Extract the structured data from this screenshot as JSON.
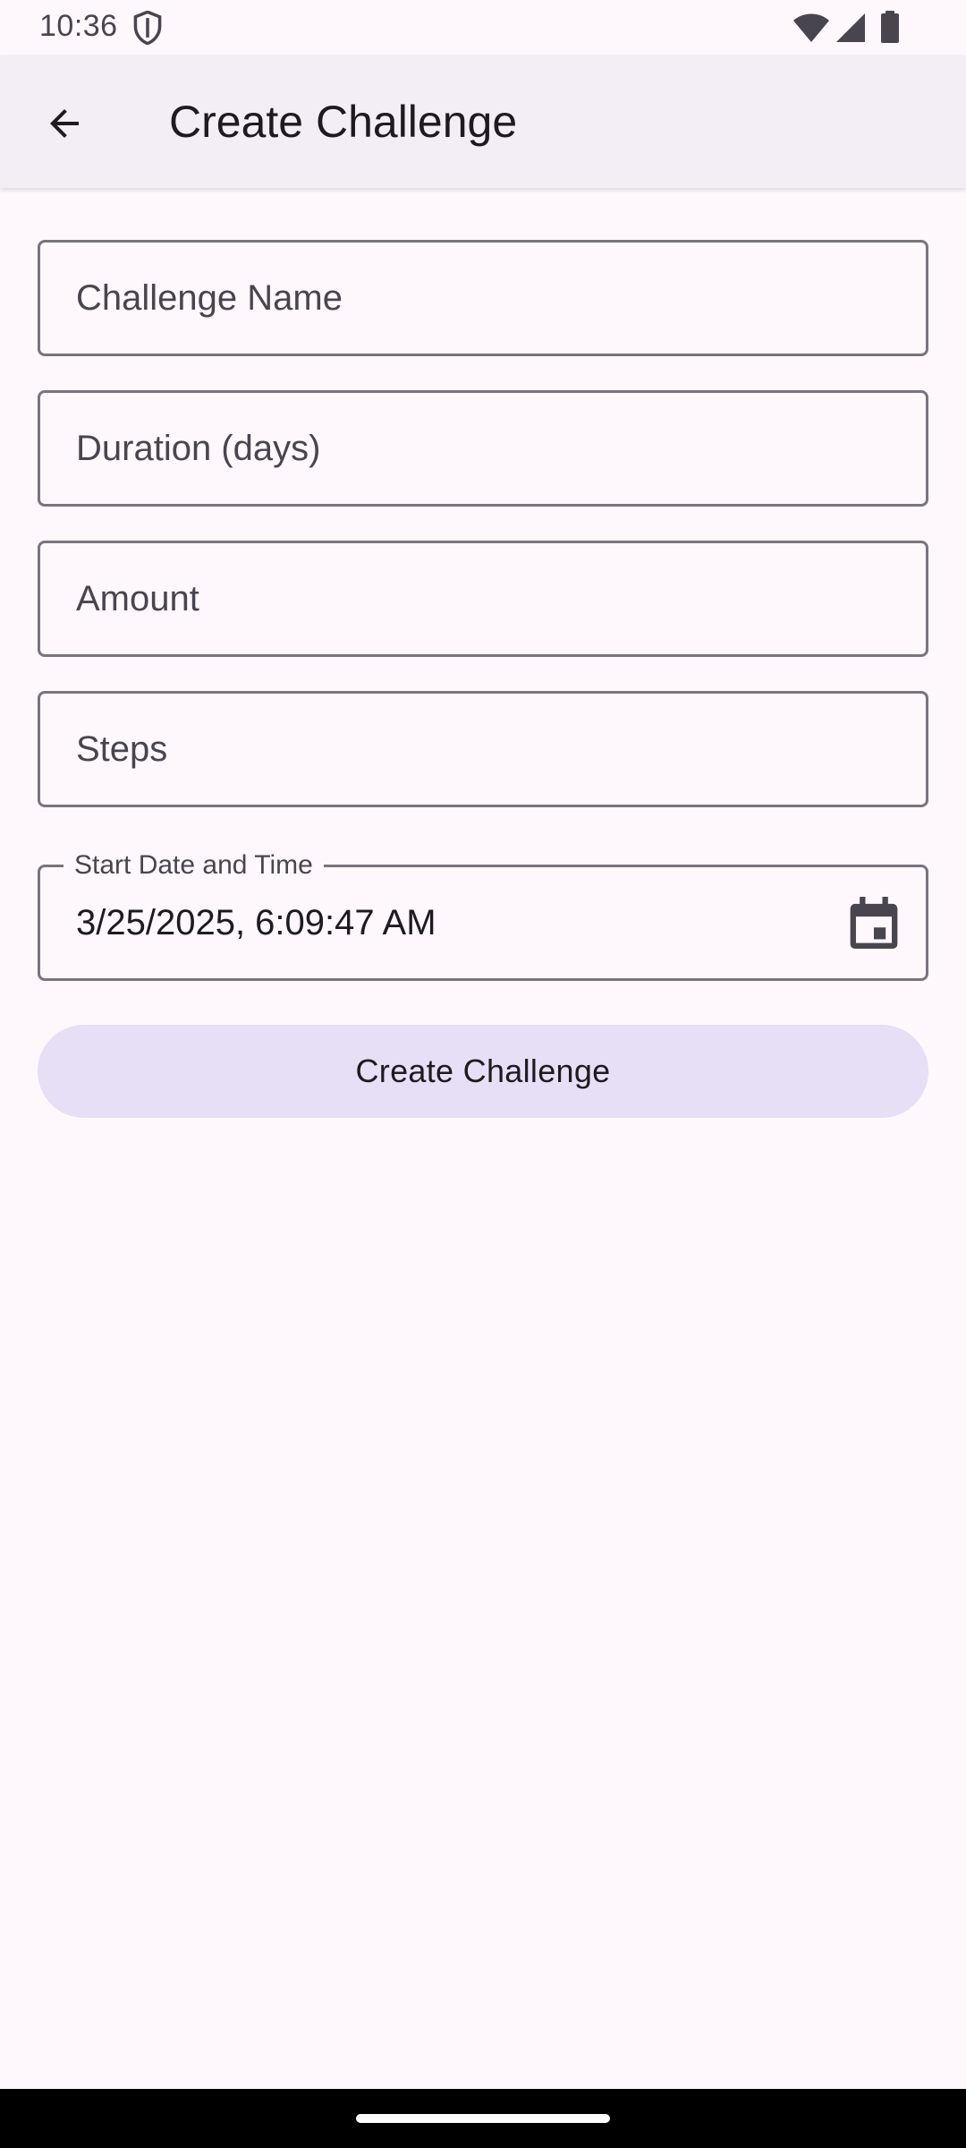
{
  "status_bar": {
    "time": "10:36",
    "icons": [
      "shield-icon",
      "wifi-icon",
      "signal-icon",
      "battery-icon"
    ]
  },
  "app_bar": {
    "back_icon": "arrow-back-icon",
    "title": "Create Challenge"
  },
  "form": {
    "challenge_name": {
      "placeholder": "Challenge Name",
      "value": ""
    },
    "duration": {
      "placeholder": "Duration (days)",
      "value": ""
    },
    "amount": {
      "placeholder": "Amount",
      "value": ""
    },
    "steps": {
      "placeholder": "Steps",
      "value": ""
    },
    "start_date": {
      "label": "Start Date and Time",
      "value": "3/25/2025, 6:09:47 AM",
      "icon": "calendar-icon"
    },
    "submit_label": "Create Challenge"
  },
  "colors": {
    "background": "#fef7fc",
    "app_bar": "#f3eef5",
    "outline": "#79747e",
    "button_container": "#e6dff5",
    "text_primary": "#1d1b20",
    "text_secondary": "#49454f"
  }
}
